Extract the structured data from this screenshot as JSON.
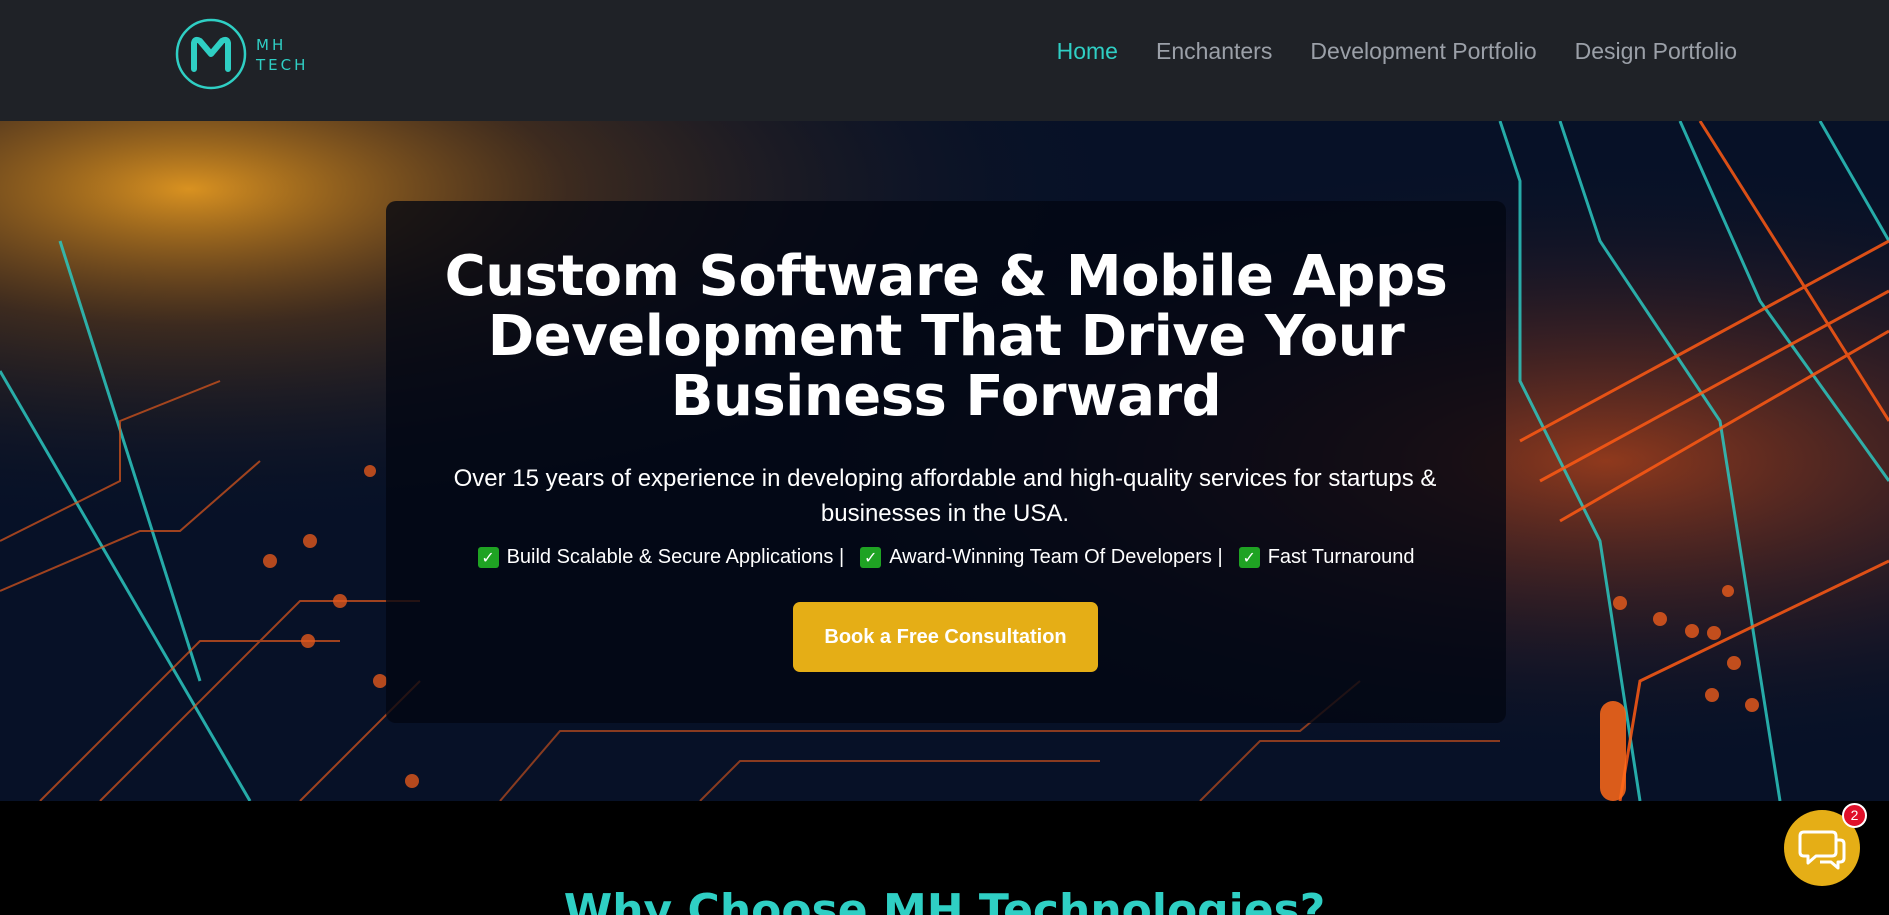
{
  "header": {
    "logo_line1": "MH",
    "logo_line2": "TECH",
    "nav": [
      {
        "label": "Home",
        "active": true
      },
      {
        "label": "Enchanters",
        "active": false
      },
      {
        "label": "Development Portfolio",
        "active": false
      },
      {
        "label": "Design Portfolio",
        "active": false
      }
    ]
  },
  "hero": {
    "title": "Custom Software & Mobile Apps Development That Drive Your Business Forward",
    "subtitle": "Over 15 years of experience in developing affordable and high-quality services for startups & businesses in the USA.",
    "features": [
      "Build Scalable & Secure Applications |",
      "Award-Winning Team Of Developers |",
      "Fast Turnaround"
    ],
    "cta_label": "Book a Free Consultation"
  },
  "section": {
    "title": "Why Choose MH Technologies?"
  },
  "chat": {
    "badge_count": "2",
    "icon": "chat-bubbles-icon"
  },
  "colors": {
    "accent": "#2fcfc4",
    "cta": "#e5ae16",
    "header_bg": "#1f2227",
    "badge": "#e0102a"
  }
}
